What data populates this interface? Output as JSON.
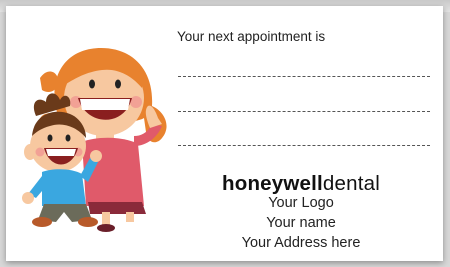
{
  "card": {
    "prompt": "Your next appointment is",
    "brand_bold": "honeywell",
    "brand_light": "dental",
    "logo_text": "Your Logo",
    "name_text": "Your name",
    "address_text": "Your Address here"
  },
  "illustration": {
    "name": "mother-and-child-smiling-illustration",
    "colors": {
      "hair_mother": "#e8822e",
      "hair_child": "#6a3a1a",
      "skin": "#f7c8a0",
      "shirt_mother": "#e05a6a",
      "shirt_child": "#3aa7e0",
      "pants_child": "#6b6b5a"
    }
  }
}
